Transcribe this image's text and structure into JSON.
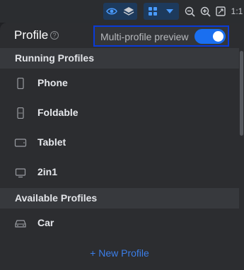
{
  "toolbar": {
    "buttons": [
      {
        "name": "eye-icon",
        "active": true
      },
      {
        "name": "layers-icon",
        "active": false
      },
      {
        "name": "grid-icon",
        "active": true
      },
      {
        "name": "dropdown-caret-icon",
        "active": true
      },
      {
        "name": "zoom-out-icon",
        "active": false
      },
      {
        "name": "zoom-in-icon",
        "active": false
      },
      {
        "name": "fit-screen-icon",
        "active": false
      }
    ],
    "ratio_label": "1:1"
  },
  "panel": {
    "title": "Profile",
    "help_glyph": "?",
    "preview_label": "Multi-profile preview",
    "preview_enabled": true
  },
  "running_section": {
    "label": "Running Profiles",
    "items": [
      {
        "label": "Phone",
        "icon": "phone-icon"
      },
      {
        "label": "Foldable",
        "icon": "foldable-icon"
      },
      {
        "label": "Tablet",
        "icon": "tablet-icon"
      },
      {
        "label": "2in1",
        "icon": "laptop-icon"
      }
    ]
  },
  "available_section": {
    "label": "Available Profiles",
    "items": [
      {
        "label": "Car",
        "icon": "car-icon"
      }
    ]
  },
  "new_profile_label": "+ New Profile",
  "colors": {
    "accent": "#1a6ff0",
    "link": "#3b7ee8",
    "highlight_border": "#0a3bd8",
    "panel_bg": "#2c2d30",
    "section_bg": "#37393d"
  }
}
